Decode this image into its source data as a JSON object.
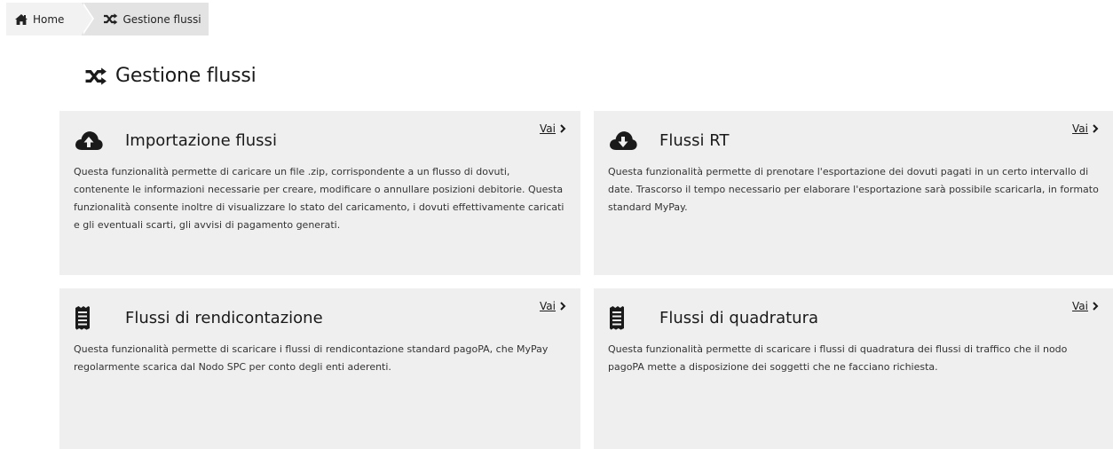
{
  "breadcrumb": {
    "home_label": "Home",
    "current_label": "Gestione flussi"
  },
  "page": {
    "title": "Gestione flussi"
  },
  "cards": [
    {
      "title": "Importazione flussi",
      "icon": "cloud-upload-icon",
      "link_label": "Vai",
      "description": "Questa funzionalità permette di caricare un file .zip, corrispondente a un flusso di dovuti, contenente le informazioni necessarie per creare, modificare o annullare posizioni debitorie. Questa funzionalità consente inoltre di visualizzare lo stato del caricamento, i dovuti effettivamente caricati e gli eventuali scarti, gli avvisi di pagamento generati."
    },
    {
      "title": "Flussi RT",
      "icon": "cloud-download-icon",
      "link_label": "Vai",
      "description": "Questa funzionalità permette di prenotare l'esportazione dei dovuti pagati in un certo intervallo di date. Trascorso il tempo necessario per elaborare l'esportazione sarà possibile scaricarla, in formato standard MyPay."
    },
    {
      "title": "Flussi di rendicontazione",
      "icon": "receipt-icon",
      "link_label": "Vai",
      "description": "Questa funzionalità permette di scaricare i flussi di rendicontazione standard pagoPA, che MyPay regolarmente scarica dal Nodo SPC per conto degli enti aderenti."
    },
    {
      "title": "Flussi di quadratura",
      "icon": "receipt-icon",
      "link_label": "Vai",
      "description": "Questa funzionalità permette di scaricare i flussi di quadratura dei flussi di traffico che il nodo pagoPA mette a disposizione dei soggetti che ne facciano richiesta."
    }
  ]
}
